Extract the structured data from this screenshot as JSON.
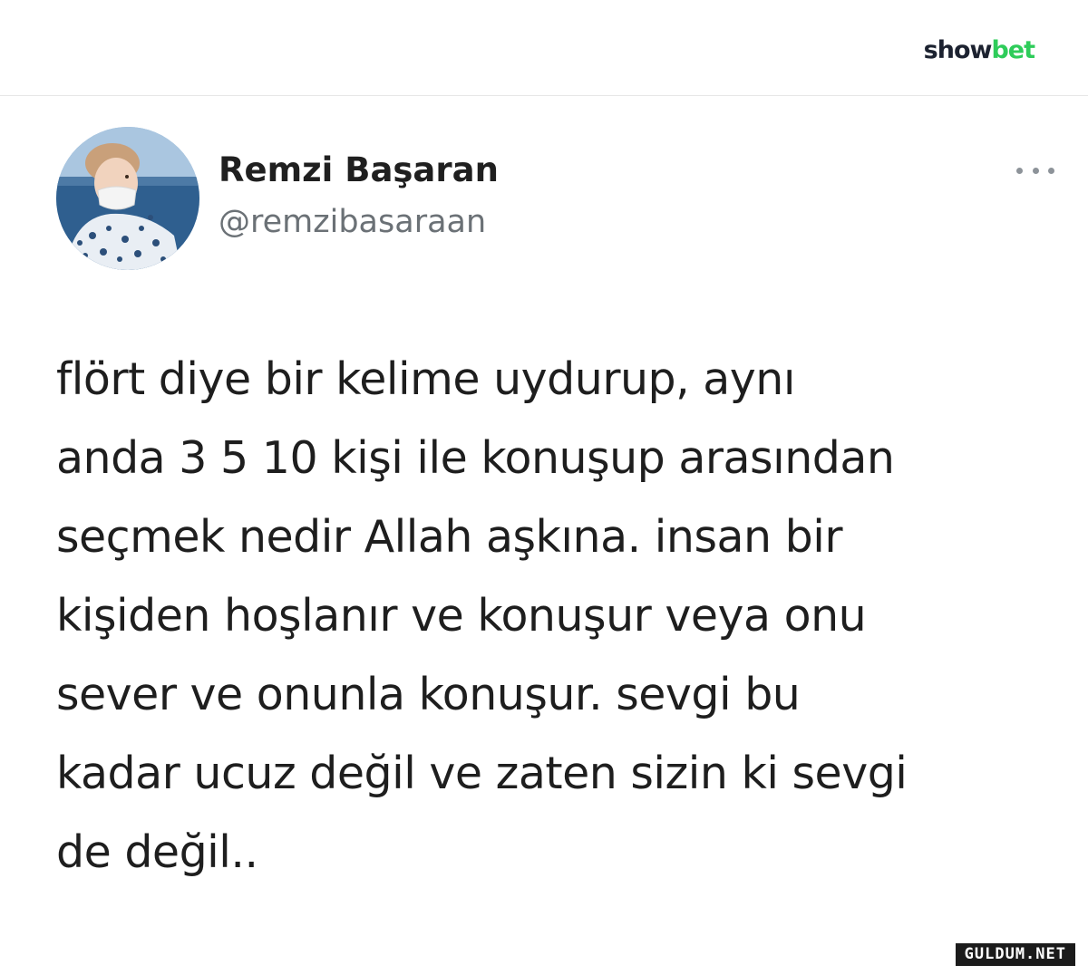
{
  "brand": {
    "part1": "show",
    "part2": "bet",
    "color_dark": "#1c2230",
    "color_green": "#2ecc5a"
  },
  "tweet": {
    "author_name": "Remzi Başaran",
    "author_handle": "@remzibasaraan",
    "more_icon": "more-horizontal-icon",
    "text_lines": [
      "flört diye bir kelime uydurup, aynı",
      "anda 3 5 10 kişi ile konuşup arasından",
      "seçmek nedir Allah aşkına. insan bir",
      "kişiden hoşlanır ve konuşur veya onu",
      "sever ve onunla konuşur. sevgi bu",
      "kadar ucuz değil ve zaten sizin ki sevgi",
      "de değil.."
    ]
  },
  "watermark": {
    "label": "GULDUM.NET"
  }
}
